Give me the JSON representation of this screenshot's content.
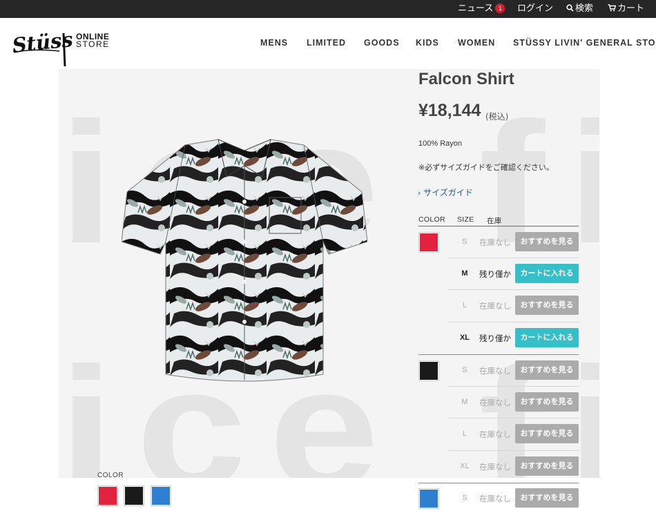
{
  "topbar": {
    "news": "ニュース",
    "news_count": "1",
    "login": "ログイン",
    "search": "検索",
    "cart": "カート"
  },
  "header": {
    "logo_text": "Stüssy",
    "online_line1": "ONLINE",
    "online_line2": "STORE",
    "nav": [
      "MENS",
      "LIMITED",
      "GOODS",
      "KIDS",
      "WOMEN",
      "STÜSSY LIVIN' GENERAL STORE"
    ]
  },
  "gallery": {
    "watermark": "ice field",
    "color_label": "COLOR",
    "thumbnails": [
      "#e2233f",
      "#1a1a1a",
      "#2f7fd0"
    ]
  },
  "product": {
    "title": "Falcon Shirt",
    "price": "¥18,144",
    "tax": "(税込)",
    "material": "100% Rayon",
    "note": "※必ずサイズガイドをご確認ください。",
    "size_guide": "サイズガイド",
    "table_headers": {
      "color": "COLOR",
      "size": "SIZE",
      "stock": "在庫"
    },
    "rows": [
      {
        "size": "S",
        "stock": "在庫なし",
        "button": "おすすめを見る",
        "available": false
      },
      {
        "size": "M",
        "stock": "残り僅か",
        "button": "カートに入れる",
        "available": true
      },
      {
        "size": "L",
        "stock": "在庫なし",
        "button": "おすすめを見る",
        "available": false
      },
      {
        "size": "XL",
        "stock": "残り僅か",
        "button": "カートに入れる",
        "available": true
      },
      {
        "size": "S",
        "stock": "在庫なし",
        "button": "おすすめを見る",
        "available": false
      },
      {
        "size": "M",
        "stock": "在庫なし",
        "button": "おすすめを見る",
        "available": false
      },
      {
        "size": "L",
        "stock": "在庫なし",
        "button": "おすすめを見る",
        "available": false
      },
      {
        "size": "XL",
        "stock": "在庫なし",
        "button": "おすすめを見る",
        "available": false
      },
      {
        "size": "S",
        "stock": "在庫なし",
        "button": "おすすめを見る",
        "available": false
      }
    ],
    "color_swatches": [
      "#e2233f",
      "#1a1a1a",
      "#2f7fd0"
    ]
  },
  "colors": {
    "accent_teal": "#34bfc9",
    "button_gray": "#ababab",
    "topbar_bg": "#262626",
    "badge_red": "#e0182e"
  }
}
